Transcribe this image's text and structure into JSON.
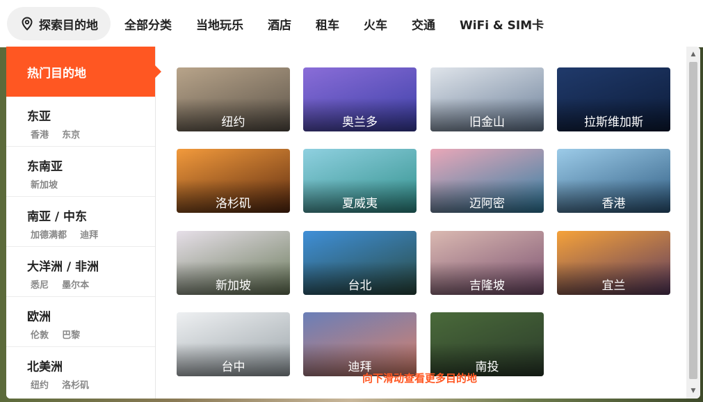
{
  "nav": {
    "search_label": "探索目的地",
    "items": [
      "全部分类",
      "当地玩乐",
      "酒店",
      "租车",
      "火车",
      "交通",
      "WiFi & SIM卡"
    ]
  },
  "sidebar": {
    "active_label": "热门目的地",
    "regions": [
      {
        "name": "东亚",
        "cities": [
          "香港",
          "东京"
        ]
      },
      {
        "name": "东南亚",
        "cities": [
          "新加坡"
        ]
      },
      {
        "name": "南亚 / 中东",
        "cities": [
          "加德满都",
          "迪拜"
        ]
      },
      {
        "name": "大洋洲 / 非洲",
        "cities": [
          "悉尼",
          "墨尔本"
        ]
      },
      {
        "name": "欧洲",
        "cities": [
          "伦敦",
          "巴黎"
        ]
      },
      {
        "name": "北美洲",
        "cities": [
          "纽约",
          "洛杉矶"
        ]
      }
    ]
  },
  "destinations": [
    {
      "name": "纽约",
      "colors": [
        "#b8a48a",
        "#5a5248"
      ]
    },
    {
      "name": "奥兰多",
      "colors": [
        "#8a6dd8",
        "#3b3fa6"
      ]
    },
    {
      "name": "旧金山",
      "colors": [
        "#dfe4ea",
        "#6b7f99"
      ]
    },
    {
      "name": "拉斯维加斯",
      "colors": [
        "#203a6b",
        "#0c1b38"
      ]
    },
    {
      "name": "洛杉矶",
      "colors": [
        "#f29a3c",
        "#5a2a10"
      ]
    },
    {
      "name": "夏威夷",
      "colors": [
        "#8fd0e0",
        "#2f8f8a"
      ]
    },
    {
      "name": "迈阿密",
      "colors": [
        "#e9a7b8",
        "#2f7fa4"
      ]
    },
    {
      "name": "香港",
      "colors": [
        "#9ccbe8",
        "#2d5a80"
      ]
    },
    {
      "name": "新加坡",
      "colors": [
        "#e6dfe8",
        "#6a7a5a"
      ]
    },
    {
      "name": "台北",
      "colors": [
        "#3f8fd8",
        "#2a4a40"
      ]
    },
    {
      "name": "吉隆坡",
      "colors": [
        "#dab9b1",
        "#7a5070"
      ]
    },
    {
      "name": "宜兰",
      "colors": [
        "#f5a23a",
        "#5a3a60"
      ]
    },
    {
      "name": "台中",
      "colors": [
        "#eef0f2",
        "#9aa3a8"
      ]
    },
    {
      "name": "迪拜",
      "colors": [
        "#6a7fb8",
        "#d8806a"
      ]
    },
    {
      "name": "南投",
      "colors": [
        "#4a6a3a",
        "#2a3a2a"
      ]
    }
  ],
  "more_hint": "向下滑动查看更多目的地",
  "accent_color": "#ff5722"
}
